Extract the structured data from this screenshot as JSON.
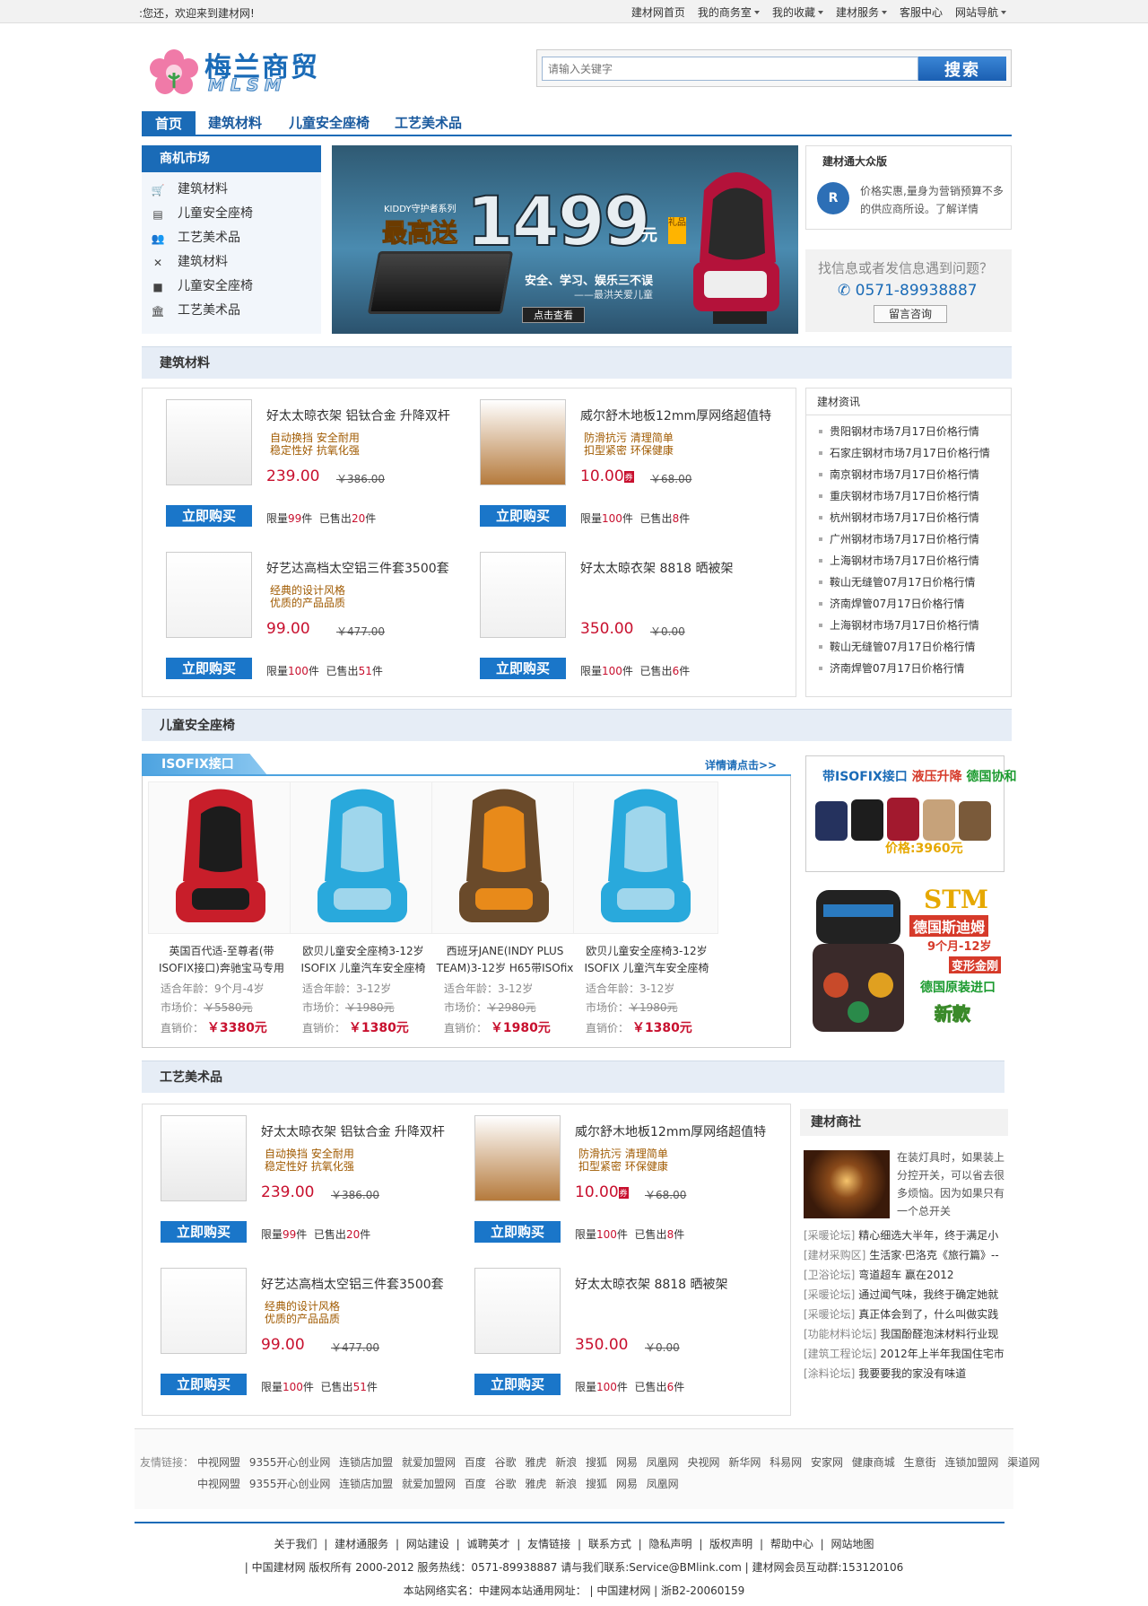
{
  "topbar": {
    "welcome": ":您还，欢迎来到建材网!",
    "links": [
      {
        "label": "建材网首页",
        "dropdown": false
      },
      {
        "label": "我的商务室",
        "dropdown": true
      },
      {
        "label": "我的收藏",
        "dropdown": true
      },
      {
        "label": "建材服务",
        "dropdown": true
      },
      {
        "label": "客服中心",
        "dropdown": false
      },
      {
        "label": "网站导航",
        "dropdown": true
      }
    ]
  },
  "header": {
    "logo_text": "梅兰商贸",
    "logo_sub": "MLSM",
    "search_placeholder": "请输入关键字",
    "search_button": "搜索"
  },
  "mainnav": [
    "首页",
    "建筑材料",
    "儿童安全座椅",
    "工艺美术品"
  ],
  "market": {
    "title": "商机市场",
    "items": [
      {
        "label": "建筑材料",
        "icon": "cart-icon"
      },
      {
        "label": "儿童安全座椅",
        "icon": "printer-icon"
      },
      {
        "label": "工艺美术品",
        "icon": "users-icon"
      },
      {
        "label": "建筑材料",
        "icon": "tools-icon"
      },
      {
        "label": "儿童安全座椅",
        "icon": "blogger-icon"
      },
      {
        "label": "工艺美术品",
        "icon": "bank-icon"
      }
    ]
  },
  "banner": {
    "series": "KIDDY守护者系列",
    "gift": "最高送",
    "price": "1499",
    "yuan": "元",
    "tag": "礼品",
    "slogan": "安全、学习、娱乐三不误",
    "brand": "——最洪关爱儿童",
    "button": "点击查看"
  },
  "dazhongban": {
    "title": "建材通大众版",
    "icon_label": "大众版",
    "text": "价格实惠,量身为营销预算不多的供应商所设。了解详情"
  },
  "help": {
    "question": "找信息或者发信息遇到问题？",
    "phone": "0571-89938887",
    "button": "留言咨询"
  },
  "section1": {
    "title": "建筑材料",
    "products": [
      {
        "name": "好太太晾衣架 铝钛合金 升降双杆",
        "feat1": "自动换挡 安全耐用",
        "feat2": "稳定性好 抗氧化强",
        "price": "239.00",
        "old": "￥386.00",
        "btn": "立即购买",
        "limit": "99",
        "sold": "20",
        "hot": false
      },
      {
        "name": "威尔舒木地板12mm厚网络超值特",
        "feat1": "防滑抗污 清理简单",
        "feat2": "扣型紧密 环保健康",
        "price": "10.00",
        "old": "￥68.00",
        "btn": "立即购买",
        "limit": "100",
        "sold": "8",
        "hot": true
      },
      {
        "name": "好艺达高档太空铝三件套3500套",
        "feat1": "经典的设计风格",
        "feat2": "优质的产品品质",
        "price": "99.00",
        "old": "￥477.00",
        "btn": "立即购买",
        "limit": "100",
        "sold": "51",
        "hot": false
      },
      {
        "name": "好太太晾衣架 8818 晒被架",
        "feat1": "",
        "feat2": "",
        "price": "350.00",
        "old": "￥0.00",
        "btn": "立即购买",
        "limit": "100",
        "sold": "6",
        "hot": false
      }
    ]
  },
  "news": {
    "title": "建材资讯",
    "items": [
      "贵阳钢材市场7月17日价格行情",
      "石家庄钢材市场7月17日价格行情",
      "南京钢材市场7月17日价格行情",
      "重庆钢材市场7月17日价格行情",
      "杭州钢材市场7月17日价格行情",
      "广州钢材市场7月17日价格行情",
      "上海钢材市场7月17日价格行情",
      "鞍山无缝管07月17日价格行情",
      "济南焊管07月17日价格行情",
      "上海钢材市场7月17日价格行情",
      "鞍山无缝管07月17日价格行情",
      "济南焊管07月17日价格行情"
    ]
  },
  "section2": {
    "title": "儿童安全座椅",
    "tab": "ISOFIX接口",
    "more": "详情请点击>>",
    "seats": [
      {
        "name1": "英国百代适-至尊者(带",
        "name2": "ISOFIX接口)奔驰宝马专用",
        "age": "9个月-4岁",
        "market": "￥5580元",
        "price": "￥3380元",
        "color": "red"
      },
      {
        "name1": "欧贝儿童安全座椅3-12岁",
        "name2": "ISOFIX 儿童汽车安全座椅",
        "age": "3-12岁",
        "market": "￥1980元",
        "price": "￥1380元",
        "color": "blue"
      },
      {
        "name1": "西班牙JANE(INDY PLUS",
        "name2": "TEAM)3-12岁 H65带ISOfix",
        "age": "3-12岁",
        "market": "￥2980元",
        "price": "￥1980元",
        "color": "brown"
      },
      {
        "name1": "欧贝儿童安全座椅3-12岁",
        "name2": "ISOFIX 儿童汽车安全座椅",
        "age": "3-12岁",
        "market": "￥1980元",
        "price": "￥1380元",
        "color": "blue"
      }
    ],
    "labels": {
      "age": "适合年龄：",
      "market": "市场价：",
      "direct": "直销价："
    },
    "ad1": {
      "t1": "带ISOFIX接口",
      "t2": "液压升降",
      "t3": "德国协和",
      "price": "价格:3960元"
    },
    "ad2": {
      "stm": "STM",
      "l1": "德国斯迪姆",
      "l2": "9个月-12岁",
      "l3": "变形金刚",
      "l4": "德国原装进口",
      "l5": "新款"
    }
  },
  "section3": {
    "title": "工艺美术品"
  },
  "shangshe": {
    "title": "建材商社",
    "lead": "在装灯具时，如果装上分控开关，可以省去很多烦恼。因为如果只有一个总开关",
    "items": [
      {
        "tag": "[采暖论坛]",
        "text": "精心细选大半年，终于满足小"
      },
      {
        "tag": "[建材采购区]",
        "text": "生活家·巴洛克《旅行篇》--"
      },
      {
        "tag": "[卫浴论坛]",
        "text": "弯道超车 赢在2012"
      },
      {
        "tag": "[采暖论坛]",
        "text": "通过闻气味，我终于确定她就"
      },
      {
        "tag": "[采暖论坛]",
        "text": "真正体会到了，什么叫做实践"
      },
      {
        "tag": "[功能材料论坛]",
        "text": "我国酚醛泡沫材料行业现"
      },
      {
        "tag": "[建筑工程论坛]",
        "text": "2012年上半年我国住宅市"
      },
      {
        "tag": "[涂料论坛]",
        "text": "我要要我的家没有味道"
      }
    ]
  },
  "friendlinks": {
    "label": "友情链接：",
    "row1": "中视网盟 9355开心创业网 连锁店加盟 就爱加盟网 百度 谷歌 雅虎 新浪 搜狐 网易 凤凰网 央视网 新华网 科易网 安家网 健康商城 生意街 连锁加盟网 渠道网",
    "row2": "中视网盟 9355开心创业网 连锁店加盟 就爱加盟网 百度 谷歌 雅虎 新浪 搜狐 网易 凤凰网"
  },
  "footer": {
    "links": "关于我们 | 建材通服务 | 网站建设 | 诚聘英才 | 友情链接 | 联系方式 | 隐私声明 | 版权声明 | 帮助中心 | 网站地图",
    "copy": "| 中国建材网 版权所有 2000-2012 服务热线：0571-89938887 请与我们联系:Service@BMlink.com | 建材网会员互动群:153120106",
    "icp": "本站网络实名：中建网本站通用网址： | 中国建材网 | 浙B2-20060159"
  },
  "colors": {
    "brand": "#1a6bb7",
    "price": "#c8102e",
    "accent": "#ffb400"
  }
}
